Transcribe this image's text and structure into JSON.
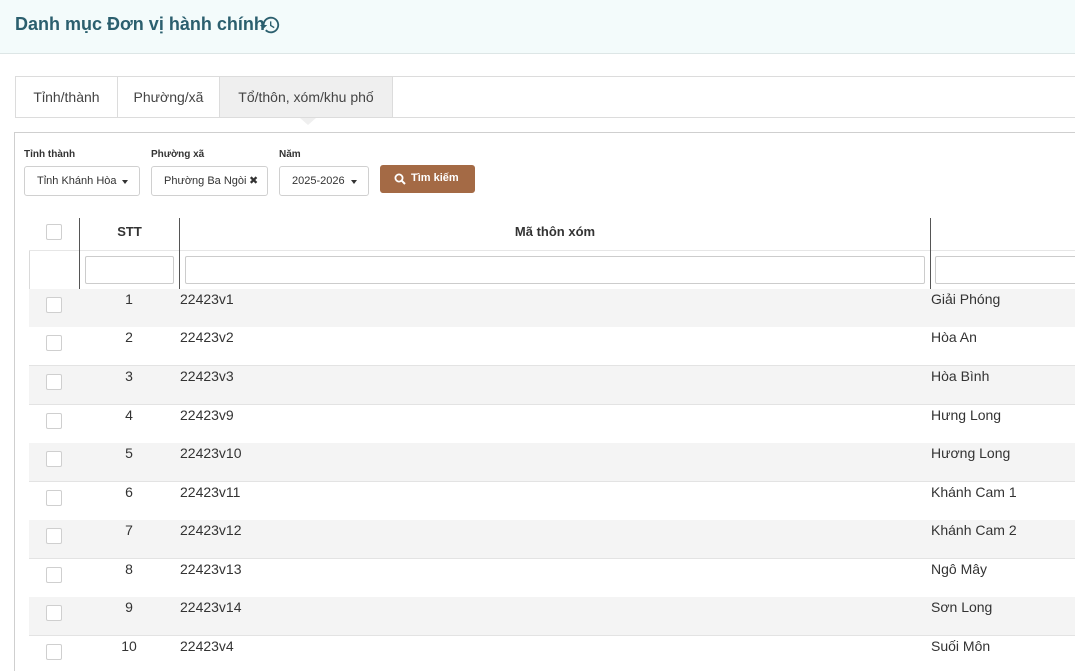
{
  "header": {
    "title": "Danh mục Đơn vị hành chính",
    "history_icon": "history-icon"
  },
  "tabs": [
    {
      "label": "Tỉnh/thành",
      "active": false
    },
    {
      "label": "Phường/xã",
      "active": false
    },
    {
      "label": "Tổ/thôn, xóm/khu phố",
      "active": true
    }
  ],
  "filters": {
    "province_label": "Tỉnh thành",
    "province_value": "Tỉnh Khánh Hòa",
    "ward_label": "Phường xã",
    "ward_value": "Phường Ba Ngòi",
    "year_label": "Năm",
    "year_value": "2025-2026",
    "search_button": "Tìm kiếm"
  },
  "table": {
    "columns": [
      "STT",
      "Mã thôn xóm"
    ],
    "rows": [
      {
        "stt": "1",
        "code": "22423v1",
        "name": "Giải Phóng"
      },
      {
        "stt": "2",
        "code": "22423v2",
        "name": "Hòa An"
      },
      {
        "stt": "3",
        "code": "22423v3",
        "name": "Hòa Bình"
      },
      {
        "stt": "4",
        "code": "22423v9",
        "name": "Hưng Long"
      },
      {
        "stt": "5",
        "code": "22423v10",
        "name": "Hương Long"
      },
      {
        "stt": "6",
        "code": "22423v11",
        "name": "Khánh Cam 1"
      },
      {
        "stt": "7",
        "code": "22423v12",
        "name": "Khánh Cam 2"
      },
      {
        "stt": "8",
        "code": "22423v13",
        "name": "Ngô Mây"
      },
      {
        "stt": "9",
        "code": "22423v14",
        "name": "Sơn Long"
      },
      {
        "stt": "10",
        "code": "22423v4",
        "name": "Suối Môn"
      }
    ]
  },
  "colors": {
    "title": "#2b5f6e",
    "header_bg": "#f3fbfb",
    "search_button": "#a46a45",
    "row_alt": "#f4f4f4"
  }
}
